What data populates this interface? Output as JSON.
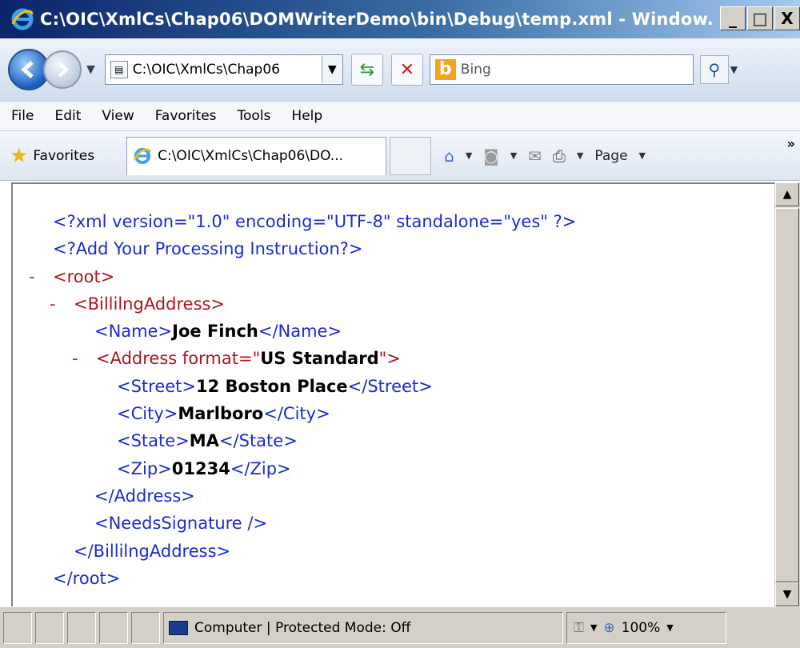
{
  "window": {
    "title": "C:\\OIC\\XmlCs\\Chap06\\DOMWriterDemo\\bin\\Debug\\temp.xml - Window...",
    "buttons": [
      "_",
      "□",
      "X"
    ]
  },
  "address_bar": {
    "address": "C:\\OIC\\XmlCs\\Chap06",
    "search_placeholder": "Bing"
  },
  "menu": [
    "File",
    "Edit",
    "View",
    "Favorites",
    "Tools",
    "Help"
  ],
  "favorites_bar": {
    "favorites_label": "Favorites",
    "tab_title": "C:\\OIC\\XmlCs\\Chap06\\DO...",
    "page_label": "Page"
  },
  "xml": {
    "decl": "<?xml version=\"1.0\" encoding=\"UTF-8\" standalone=\"yes\" ?>",
    "pi": "<?Add Your Processing Instruction?>",
    "minus": "-",
    "root_open": "<root>",
    "billing_open": "<BillilngAddress>",
    "name_open": "<Name>",
    "name_value": "Joe Finch",
    "name_close": "</Name>",
    "address_open_start": "<Address format=\"",
    "address_format": "US Standard",
    "address_open_end": "\">",
    "street_open": "<Street>",
    "street_value": "12 Boston Place",
    "street_close": "</Street>",
    "city_open": "<City>",
    "city_value": "Marlboro",
    "city_close": "</City>",
    "state_open": "<State>",
    "state_value": "MA",
    "state_close": "</State>",
    "zip_open": "<Zip>",
    "zip_value": "01234",
    "zip_close": "</Zip>",
    "address_close": "</Address>",
    "needs_signature": "<NeedsSignature />",
    "billing_close": "</BillilngAddress>",
    "root_close": "</root>"
  },
  "status_bar": {
    "zone": "Computer | Protected Mode: Off",
    "zoom": "100%"
  },
  "colors": {
    "markup_blue": "#1b2bd1",
    "tag_red": "#b0151f",
    "collapse_red": "#d21d1d"
  }
}
